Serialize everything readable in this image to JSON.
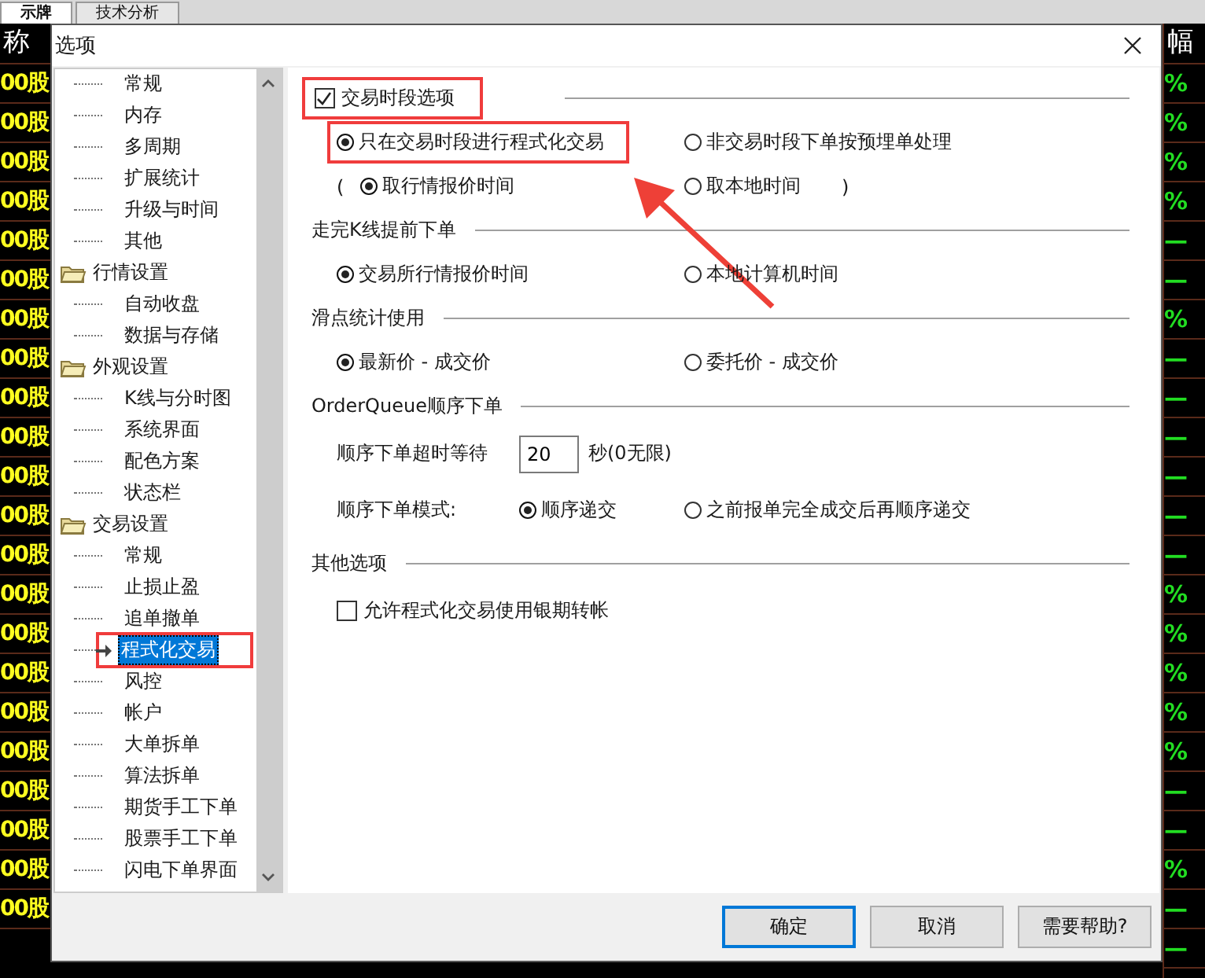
{
  "background": {
    "tabs": [
      {
        "label": "示牌",
        "selected": true
      },
      {
        "label": "技术分析",
        "selected": false
      }
    ],
    "left_header": "称",
    "right_header": "幅",
    "left_cells": [
      "00股",
      "00股",
      "00股",
      "00股",
      "00股",
      "00股",
      "00股",
      "00股",
      "00股",
      "00股",
      "00股",
      "00股",
      "00股",
      "00股",
      "00股",
      "00股",
      "00股",
      "00股",
      "00股",
      "00股",
      "00股",
      "00股"
    ],
    "right_cells": [
      "%",
      "%",
      "%",
      "%",
      "—",
      "—",
      "%",
      "—",
      "—",
      "—",
      "—",
      "—",
      "—",
      "%",
      "%",
      "%",
      "%",
      "%",
      "—",
      "—",
      "%",
      "—",
      "—"
    ]
  },
  "window": {
    "title": "选项"
  },
  "tree": [
    {
      "children": [
        {
          "label": "常规",
          "selected": false
        },
        {
          "label": "内存",
          "selected": false
        },
        {
          "label": "多周期",
          "selected": false
        },
        {
          "label": "扩展统计",
          "selected": false
        },
        {
          "label": "升级与时间",
          "selected": false
        },
        {
          "label": "其他",
          "selected": false
        }
      ]
    },
    {
      "label": "行情设置",
      "children": [
        {
          "label": "自动收盘",
          "selected": false
        },
        {
          "label": "数据与存储",
          "selected": false
        }
      ]
    },
    {
      "label": "外观设置",
      "children": [
        {
          "label": "K线与分时图",
          "selected": false
        },
        {
          "label": "系统界面",
          "selected": false
        },
        {
          "label": "配色方案",
          "selected": false
        },
        {
          "label": "状态栏",
          "selected": false
        }
      ]
    },
    {
      "label": "交易设置",
      "children": [
        {
          "label": "常规",
          "selected": false
        },
        {
          "label": "止损止盈",
          "selected": false
        },
        {
          "label": "追单撤单",
          "selected": false
        },
        {
          "label": "程式化交易",
          "selected": true,
          "highlighted": true
        },
        {
          "label": "风控",
          "selected": false
        },
        {
          "label": "帐户",
          "selected": false
        },
        {
          "label": "大单拆单",
          "selected": false
        },
        {
          "label": "算法拆单",
          "selected": false
        },
        {
          "label": "期货手工下单",
          "selected": false
        },
        {
          "label": "股票手工下单",
          "selected": false
        },
        {
          "label": "闪电下单界面",
          "selected": false
        }
      ]
    }
  ],
  "sections": [
    {
      "header": {
        "kind": "checkbox",
        "label": "交易时段选项",
        "checked": true,
        "highlighted": true
      },
      "rows": [
        {
          "kind": "radios",
          "options": [
            {
              "label": "只在交易时段进行程式化交易",
              "selected": true,
              "highlighted": true
            },
            {
              "label": "非交易时段下单按预埋单处理",
              "selected": false
            }
          ]
        },
        {
          "kind": "radios",
          "open": "(",
          "close": ")",
          "options": [
            {
              "label": "取行情报价时间",
              "selected": true
            },
            {
              "label": "取本地时间",
              "selected": false
            }
          ]
        }
      ]
    },
    {
      "header": {
        "kind": "text",
        "label": "走完K线提前下单"
      },
      "rows": [
        {
          "kind": "radios",
          "options": [
            {
              "label": "交易所行情报价时间",
              "selected": true
            },
            {
              "label": "本地计算机时间",
              "selected": false
            }
          ]
        }
      ]
    },
    {
      "header": {
        "kind": "text",
        "label": "滑点统计使用"
      },
      "rows": [
        {
          "kind": "radios",
          "options": [
            {
              "label": "最新价 - 成交价",
              "selected": true
            },
            {
              "label": "委托价 - 成交价",
              "selected": false
            }
          ]
        }
      ]
    },
    {
      "header": {
        "kind": "text",
        "label": "OrderQueue顺序下单"
      },
      "rows": [
        {
          "kind": "field",
          "label": "顺序下单超时等待",
          "value": "20",
          "suffix": "秒(0无限)"
        },
        {
          "kind": "labeled_radios",
          "label": "顺序下单模式:",
          "options": [
            {
              "label": "顺序递交",
              "selected": true
            },
            {
              "label": "之前报单完全成交后再顺序递交",
              "selected": false
            }
          ]
        }
      ]
    },
    {
      "header": {
        "kind": "text",
        "label": "其他选项"
      },
      "rows": [
        {
          "kind": "checkbox",
          "label": "允许程式化交易使用银期转帐",
          "checked": false
        }
      ]
    }
  ],
  "buttons": [
    {
      "label": "确定",
      "default": true
    },
    {
      "label": "取消",
      "default": false
    },
    {
      "label": "需要帮助?",
      "default": false
    }
  ]
}
